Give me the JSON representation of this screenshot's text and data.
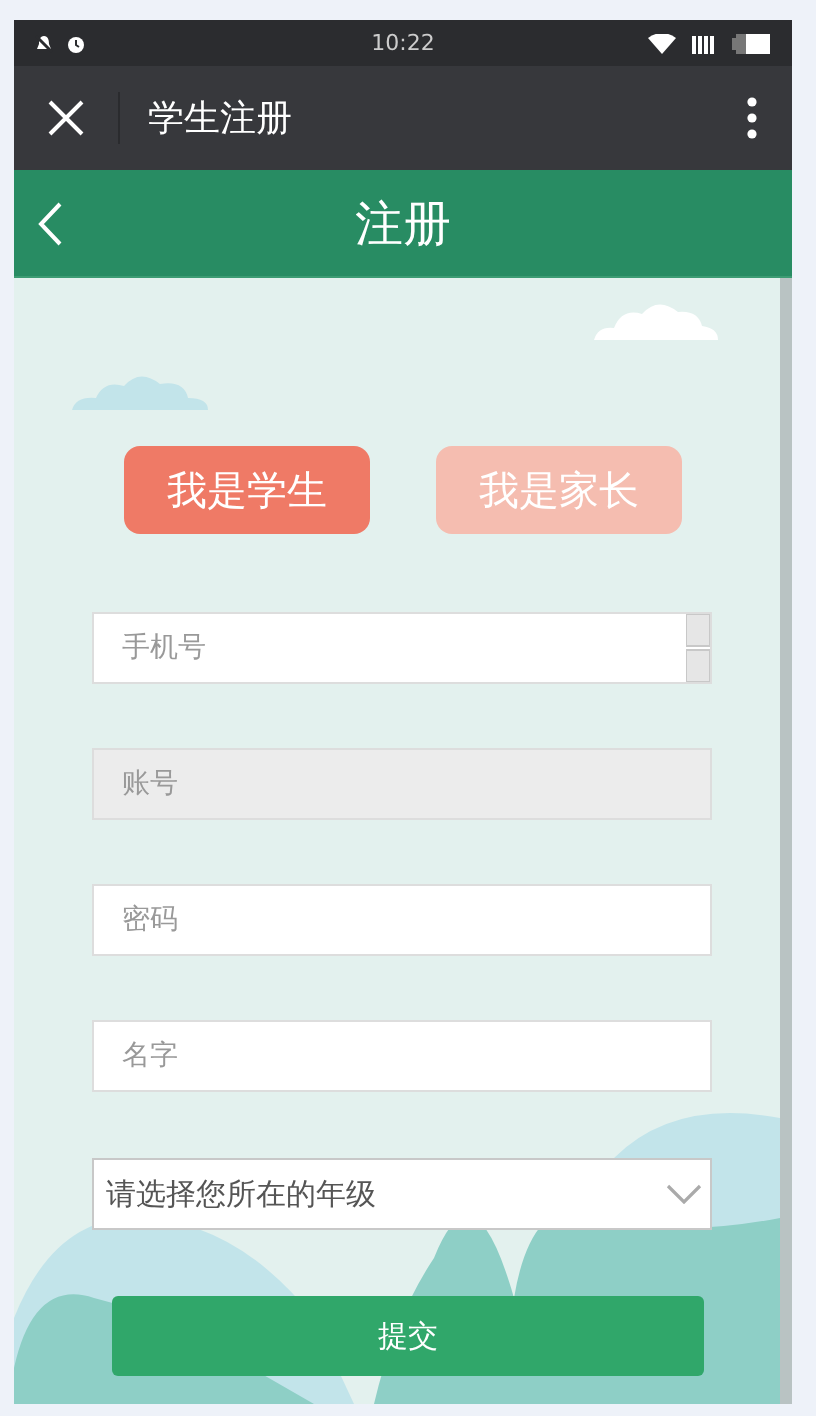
{
  "status_bar": {
    "time": "10:22"
  },
  "app_bar": {
    "title": "学生注册"
  },
  "header": {
    "title": "注册"
  },
  "roles": [
    {
      "label": "我是学生",
      "selected": true
    },
    {
      "label": "我是家长",
      "selected": false
    }
  ],
  "fields": [
    {
      "kind": "number",
      "placeholder": "手机号",
      "disabled": false
    },
    {
      "kind": "text",
      "placeholder": "账号",
      "disabled": true
    },
    {
      "kind": "password",
      "placeholder": "密码",
      "disabled": false
    },
    {
      "kind": "text",
      "placeholder": "名字",
      "disabled": false
    }
  ],
  "grade_select": {
    "placeholder": "请选择您所在的年级"
  },
  "submit_button": {
    "label": "提交"
  }
}
